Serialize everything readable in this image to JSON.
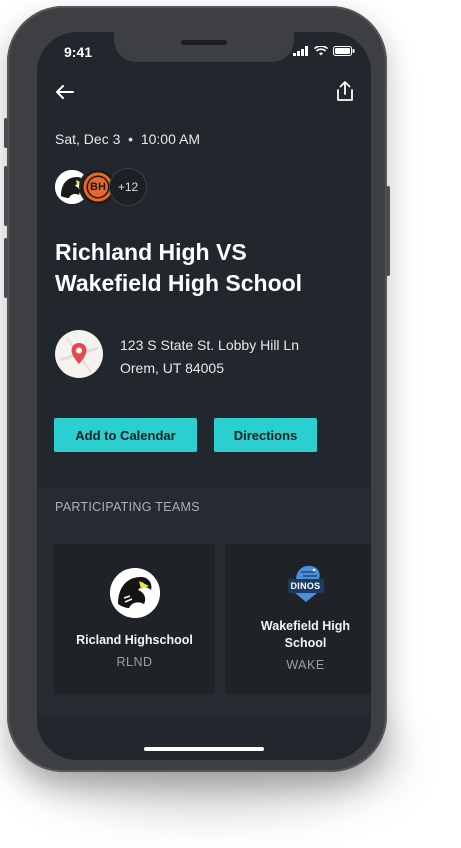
{
  "status_bar": {
    "time": "9:41"
  },
  "nav": {
    "back_icon": "arrow-left-icon",
    "share_icon": "share-icon"
  },
  "event": {
    "datetime": "Sat, Dec 3  •  10:00 AM",
    "attendees_more": "+12",
    "title_line1": "Richland High VS",
    "title_line2": "Wakefield High School",
    "address_line1": "123 S State St. Lobby Hill Ln",
    "address_line2": "Orem, UT 84005"
  },
  "actions": {
    "add_to_calendar": "Add to Calendar",
    "directions": "Directions"
  },
  "teams_section": {
    "header": "PARTICIPATING TEAMS",
    "teams": [
      {
        "name": "Ricland Highschool",
        "abbr": "RLND"
      },
      {
        "name": "Wakefield High School",
        "abbr": "WAKE",
        "logo_text": "DINOS"
      }
    ]
  },
  "colors": {
    "accent": "#2ccfcf",
    "background": "#22272d",
    "card": "#1f2328",
    "section": "#262b31"
  },
  "logos": {
    "bh_text": "BH"
  }
}
